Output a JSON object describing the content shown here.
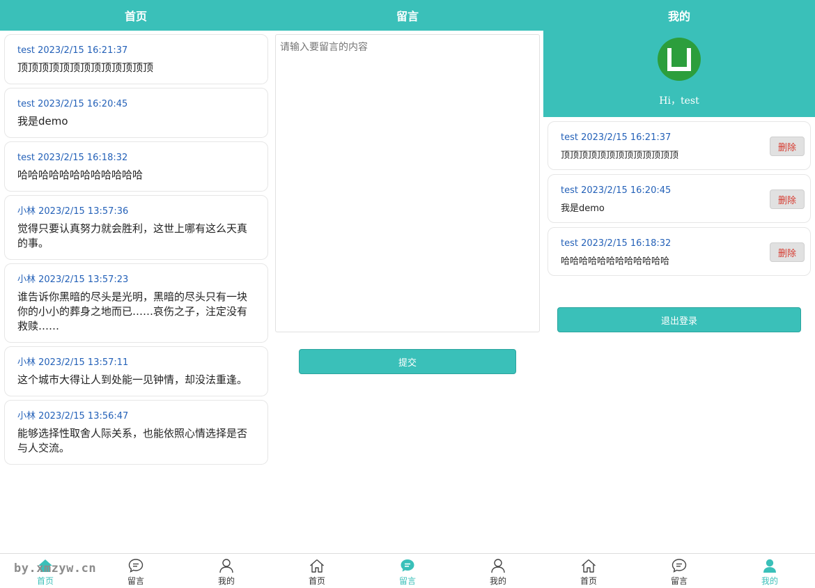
{
  "theme": {
    "accent": "#3ac0b9",
    "meta_color": "#2461b8",
    "danger": "#d63a2f",
    "avatar": "#2c9e3c"
  },
  "home": {
    "title": "首页",
    "posts": [
      {
        "meta": "test 2023/2/15 16:21:37",
        "content": "顶顶顶顶顶顶顶顶顶顶顶顶顶"
      },
      {
        "meta": "test 2023/2/15 16:20:45",
        "content": "我是demo"
      },
      {
        "meta": "test 2023/2/15 16:18:32",
        "content": "哈哈哈哈哈哈哈哈哈哈哈哈"
      },
      {
        "meta": "小林 2023/2/15 13:57:36",
        "content": "觉得只要认真努力就会胜利，这世上哪有这么天真的事。"
      },
      {
        "meta": "小林 2023/2/15 13:57:23",
        "content": "谁告诉你黑暗的尽头是光明，黑暗的尽头只有一块你的小小的葬身之地而已……哀伤之子，注定没有救赎……"
      },
      {
        "meta": "小林 2023/2/15 13:57:11",
        "content": "这个城市大得让人到处能一见钟情，却没法重逢。"
      },
      {
        "meta": "小林 2023/2/15 13:56:47",
        "content": "能够选择性取舍人际关系，也能依照心情选择是否与人交流。"
      }
    ]
  },
  "message": {
    "title": "留言",
    "placeholder": "请输入要留言的内容",
    "submit_label": "提交"
  },
  "mine": {
    "title": "我的",
    "avatar_icon": "avatar-u-icon",
    "greeting": "Hi，test",
    "posts": [
      {
        "meta": "test 2023/2/15 16:21:37",
        "content": "顶顶顶顶顶顶顶顶顶顶顶顶顶",
        "delete_label": "删除"
      },
      {
        "meta": "test 2023/2/15 16:20:45",
        "content": "我是demo",
        "delete_label": "删除"
      },
      {
        "meta": "test 2023/2/15 16:18:32",
        "content": "哈哈哈哈哈哈哈哈哈哈哈哈",
        "delete_label": "删除"
      }
    ],
    "logout_label": "退出登录"
  },
  "tabbar": {
    "home": {
      "label": "首页",
      "icon": "home-icon"
    },
    "message": {
      "label": "留言",
      "icon": "message-icon"
    },
    "mine": {
      "label": "我的",
      "icon": "user-icon"
    }
  },
  "watermark": "by.xmzyw.cn"
}
